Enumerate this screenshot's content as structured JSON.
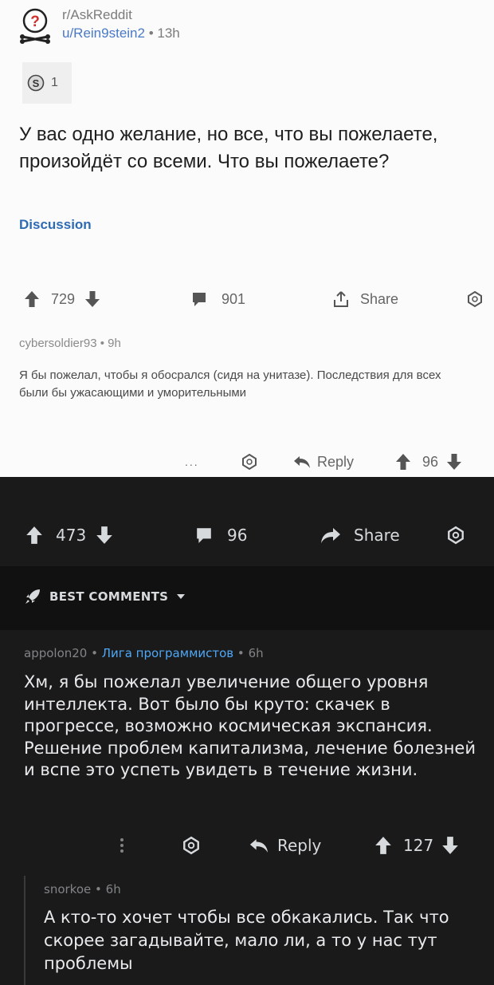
{
  "post": {
    "subreddit": "r/AskReddit",
    "username": "u/Rein9stein2",
    "separator": "•",
    "age": "13h",
    "award_count": "1",
    "title": "У вас одно желание, но все, что вы пожелаете, произойдёт со всеми. Что вы пожелаете?",
    "flair": "Discussion",
    "upvotes": "729",
    "comments": "901",
    "share_label": "Share"
  },
  "screenshot_comment": {
    "author": "cybersoldier93",
    "age": "9h",
    "body": "Я бы пожелал, чтобы я обосрался (сидя на унитазе). Последствия для всех были бы ужасающими и уморительными",
    "more": "...",
    "reply_label": "Reply",
    "votes": "96"
  },
  "outer_post": {
    "votes": "473",
    "comments": "96",
    "share_label": "Share"
  },
  "sort": {
    "label": "BEST COMMENTS"
  },
  "comment": {
    "author": "appolon20",
    "community": "Лига программистов",
    "age": "6h",
    "body": "Хм, я бы пожелал увеличение общего уровня интеллекта. Вот было бы круто: скачек в прогрессе, возможно космическая экспансия. Решение проблем капитализма, лечение болезней и вспе это успеть увидеть в течение жизни.",
    "reply_label": "Reply",
    "votes": "127"
  },
  "reply": {
    "author": "snorkoe",
    "age": "6h",
    "body": "А кто-то хочет чтобы все обкакались. Так что скорее загадывайте, мало ли, а то у нас тут проблемы"
  },
  "colors": {
    "dark_bg": "#1a1a1b",
    "link_blue": "#4fa8f5",
    "flair_blue": "#2e6bb5"
  }
}
